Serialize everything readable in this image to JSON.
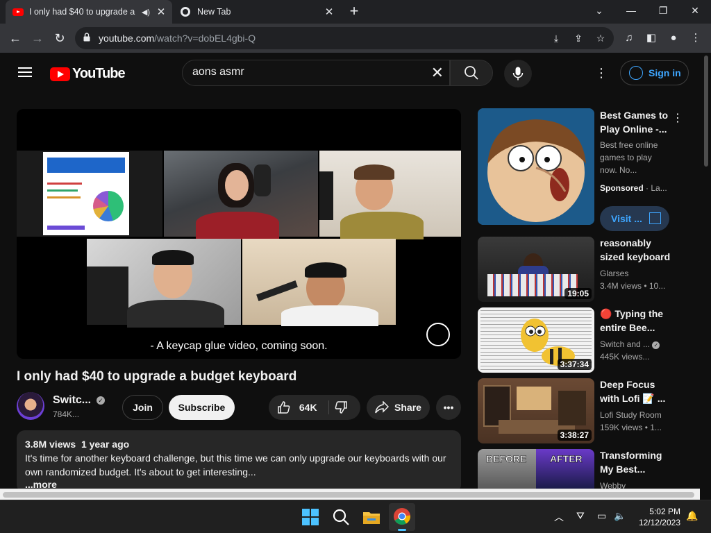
{
  "browser": {
    "tabs": [
      {
        "title": "I only had $40 to upgrade a",
        "active": true
      },
      {
        "title": "New Tab",
        "active": false
      }
    ],
    "url_host": "youtube.com",
    "url_path": "/watch?v=dobEL4gbi-Q"
  },
  "header": {
    "logo": "YouTube",
    "search_value": "aons asmr",
    "signin_label": "Sign in"
  },
  "video": {
    "caption": "- A keycap glue video, coming soon.",
    "title": "I only had $40 to upgrade a budget keyboard",
    "channel_name": "Switc...",
    "subscribers": "784K...",
    "join_label": "Join",
    "subscribe_label": "Subscribe",
    "likes": "64K",
    "share_label": "Share",
    "views": "3.8M views",
    "age": "1 year ago",
    "description": "It's time for another keyboard challenge, but this time we can only upgrade our keyboards with our own randomized budget. It's about to get interesting...",
    "more_label": "...more"
  },
  "sidebar": {
    "ad": {
      "title_line1": "Best Games to",
      "title_line2": "Play Online -...",
      "desc1": "Best free online",
      "desc2": "games to play",
      "desc3": "now. No...",
      "sponsored": "Sponsored",
      "advertiser": "· La...",
      "visit_label": "Visit ..."
    },
    "items": [
      {
        "title1": "reasonably",
        "title2": "sized keyboard",
        "channel": "Glarses",
        "stats": "3.4M views  • 10...",
        "duration": "19:05"
      },
      {
        "title1": "🔴 Typing the",
        "title2": "entire Bee...",
        "channel": "Switch and ...",
        "stats": "445K views...",
        "duration": "3:37:34"
      },
      {
        "title1": "Deep Focus",
        "title2": "with Lofi 📝 ...",
        "channel": "Lofi Study Room",
        "stats": "159K views  • 1...",
        "duration": "3:38:27"
      },
      {
        "title1": "Transforming",
        "title2": "My Best...",
        "channel": "Webby",
        "stats": "",
        "duration": ""
      }
    ],
    "before_label": "BEFORE",
    "after_label": "AFTER"
  },
  "taskbar": {
    "time": "5:02 PM",
    "date": "12/12/2023"
  }
}
